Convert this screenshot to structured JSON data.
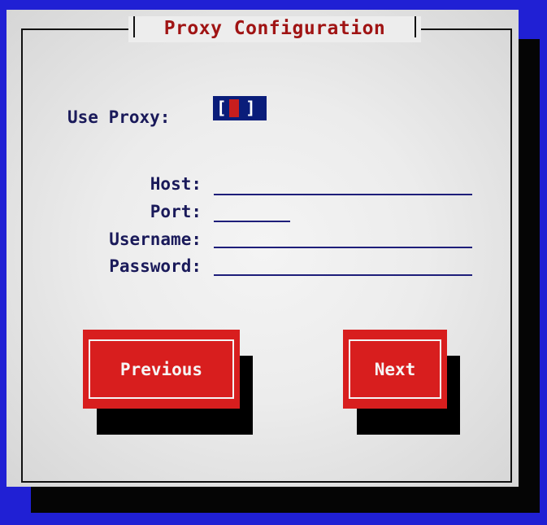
{
  "dialog": {
    "title": "Proxy Configuration"
  },
  "use_proxy": {
    "label": "Use Proxy:",
    "checked": true,
    "bracket_open": "[",
    "bracket_close": "]"
  },
  "fields": {
    "host": {
      "label": "Host:",
      "value": ""
    },
    "port": {
      "label": "Port:",
      "value": ""
    },
    "username": {
      "label": "Username:",
      "value": ""
    },
    "password": {
      "label": "Password:",
      "value": ""
    }
  },
  "buttons": {
    "previous": "Previous",
    "next": "Next"
  },
  "colors": {
    "background": "#2020d4",
    "title": "#a01414",
    "label": "#1a1a5a",
    "button": "#d81e1e",
    "checkbox_bg": "#0a1d7a"
  }
}
